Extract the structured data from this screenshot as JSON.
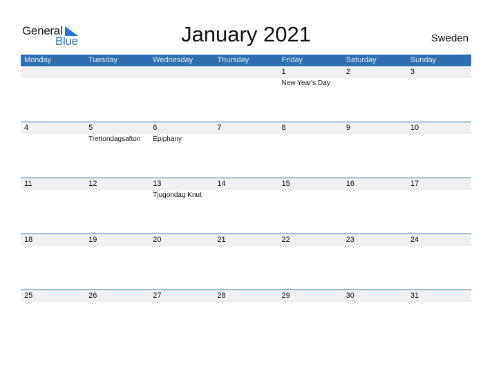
{
  "logo": {
    "line1": "General",
    "line2": "Blue"
  },
  "title": "January 2021",
  "country": "Sweden",
  "colors": {
    "accent": "#2e6fb1",
    "band": "#f0f0f0",
    "logo_blue": "#1f78c8"
  },
  "weekdays": [
    "Monday",
    "Tuesday",
    "Wednesday",
    "Thursday",
    "Friday",
    "Saturday",
    "Sunday"
  ],
  "weeks": [
    [
      {
        "d": ""
      },
      {
        "d": ""
      },
      {
        "d": ""
      },
      {
        "d": ""
      },
      {
        "d": "1",
        "h": "New Year's Day"
      },
      {
        "d": "2"
      },
      {
        "d": "3"
      }
    ],
    [
      {
        "d": "4"
      },
      {
        "d": "5",
        "h": "Trettondagsafton"
      },
      {
        "d": "6",
        "h": "Epiphany"
      },
      {
        "d": "7"
      },
      {
        "d": "8"
      },
      {
        "d": "9"
      },
      {
        "d": "10"
      }
    ],
    [
      {
        "d": "11"
      },
      {
        "d": "12"
      },
      {
        "d": "13",
        "h": "Tjugondag Knut"
      },
      {
        "d": "14"
      },
      {
        "d": "15"
      },
      {
        "d": "16"
      },
      {
        "d": "17"
      }
    ],
    [
      {
        "d": "18"
      },
      {
        "d": "19"
      },
      {
        "d": "20"
      },
      {
        "d": "21"
      },
      {
        "d": "22"
      },
      {
        "d": "23"
      },
      {
        "d": "24"
      }
    ],
    [
      {
        "d": "25"
      },
      {
        "d": "26"
      },
      {
        "d": "27"
      },
      {
        "d": "28"
      },
      {
        "d": "29"
      },
      {
        "d": "30"
      },
      {
        "d": "31"
      }
    ]
  ]
}
